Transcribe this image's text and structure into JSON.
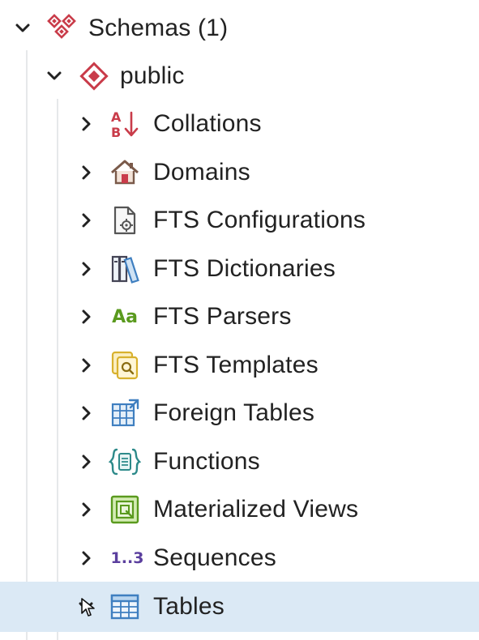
{
  "tree": {
    "schemas": {
      "label": "Schemas (1)",
      "icon": "schemas-icon",
      "expanded": true
    },
    "public": {
      "label": "public",
      "icon": "schema-icon",
      "expanded": true
    },
    "items": [
      {
        "label": "Collations",
        "icon": "collation-sort-icon",
        "expanded": false
      },
      {
        "label": "Domains",
        "icon": "domain-house-icon",
        "expanded": false
      },
      {
        "label": "FTS Configurations",
        "icon": "fts-configuration-icon",
        "expanded": false
      },
      {
        "label": "FTS Dictionaries",
        "icon": "fts-dictionary-icon",
        "expanded": false
      },
      {
        "label": "FTS Parsers",
        "icon": "fts-parser-icon",
        "icon_text": "Aa",
        "expanded": false
      },
      {
        "label": "FTS Templates",
        "icon": "fts-template-icon",
        "expanded": false
      },
      {
        "label": "Foreign Tables",
        "icon": "foreign-table-icon",
        "expanded": false
      },
      {
        "label": "Functions",
        "icon": "function-icon",
        "expanded": false
      },
      {
        "label": "Materialized Views",
        "icon": "materialized-view-icon",
        "expanded": false
      },
      {
        "label": "Sequences",
        "icon": "sequence-icon",
        "icon_text": "1..3",
        "expanded": false
      },
      {
        "label": "Tables",
        "icon": "table-icon",
        "expanded": true,
        "selected": true
      }
    ]
  },
  "colors": {
    "selected_row": "#dbe9f5",
    "schema_red": "#c93c4a",
    "parser_green": "#5a9a1e",
    "sequence_purple": "#5b3f9e",
    "table_blue": "#3f7fc0",
    "template_yellow": "#e6c23a"
  }
}
